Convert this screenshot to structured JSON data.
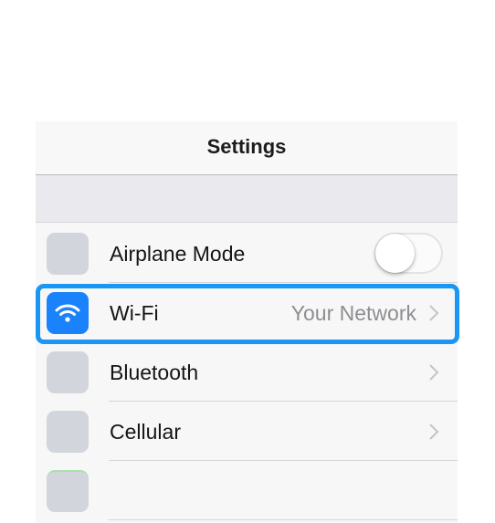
{
  "nav": {
    "title": "Settings"
  },
  "rows": [
    {
      "label": "Airplane Mode",
      "control": "toggle",
      "toggle_on": false,
      "icon": "placeholder-icon"
    },
    {
      "label": "Wi-Fi",
      "value": "Your Network",
      "control": "chevron",
      "icon": "wifi-icon",
      "highlighted": true
    },
    {
      "label": "Bluetooth",
      "control": "chevron",
      "icon": "placeholder-icon"
    },
    {
      "label": "Cellular",
      "control": "chevron",
      "icon": "placeholder-icon"
    },
    {
      "label": "",
      "icon": "placeholder-icon"
    }
  ],
  "colors": {
    "accent": "#1a82fb",
    "highlight": "#1a97f5",
    "icon_placeholder": "#d2d5dc",
    "secondary_text": "#8e8e93"
  }
}
